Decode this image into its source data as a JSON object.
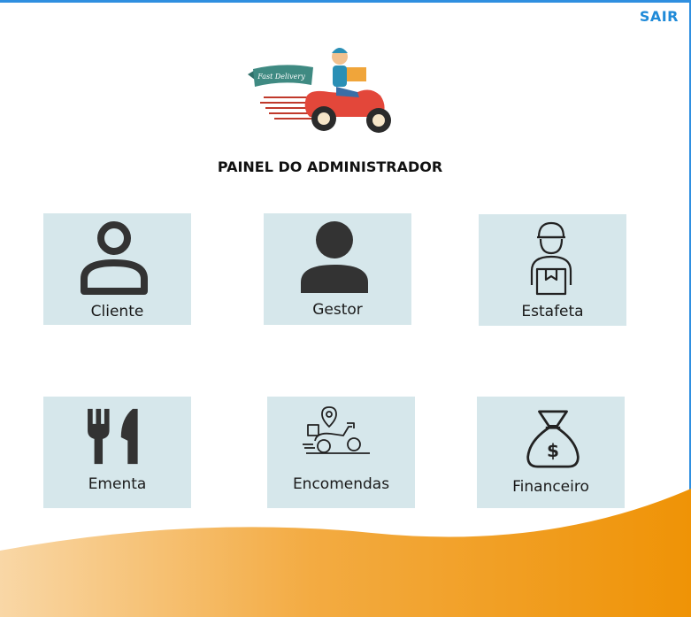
{
  "header": {
    "logout_label": "SAIR"
  },
  "logo": {
    "banner_text": "Fast Delivery"
  },
  "page": {
    "title": "PAINEL DO ADMINISTRADOR"
  },
  "tiles": [
    {
      "label": "Cliente",
      "icon": "user-outline-icon"
    },
    {
      "label": "Gestor",
      "icon": "user-filled-icon"
    },
    {
      "label": "Estafeta",
      "icon": "courier-icon"
    },
    {
      "label": "Ementa",
      "icon": "fork-knife-icon"
    },
    {
      "label": "Encomendas",
      "icon": "delivery-scooter-icon"
    },
    {
      "label": "Financeiro",
      "icon": "money-bag-icon"
    }
  ],
  "colors": {
    "accent": "#1f8ad8",
    "tile_bg": "#d6e7eb",
    "wave_light": "#f7c98a",
    "wave_dark": "#f19a12"
  }
}
